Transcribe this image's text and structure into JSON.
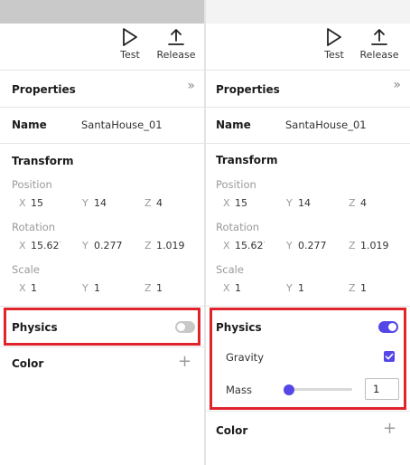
{
  "toolbar": {
    "test_label": "Test",
    "test_icon": "play-icon",
    "release_label": "Release",
    "release_icon": "upload-icon"
  },
  "properties": {
    "title": "Properties",
    "collapse_icon": "double-chevron-right-icon",
    "collapse_glyph": "»"
  },
  "name_field": {
    "label": "Name",
    "value": "SantaHouse_01"
  },
  "transform": {
    "title": "Transform",
    "position": {
      "label": "Position",
      "x_axis": "X",
      "y_axis": "Y",
      "z_axis": "Z",
      "x": "15",
      "y": "14",
      "z": "4"
    },
    "rotation": {
      "label": "Rotation",
      "x_axis": "X",
      "y_axis": "Y",
      "z_axis": "Z",
      "x": "15.627",
      "y": "0.277",
      "z": "1.019"
    },
    "scale": {
      "label": "Scale",
      "x_axis": "X",
      "y_axis": "Y",
      "z_axis": "Z",
      "x": "1",
      "y": "1",
      "z": "1"
    }
  },
  "physics_left": {
    "label": "Physics",
    "enabled": false
  },
  "physics_right": {
    "label": "Physics",
    "enabled": true,
    "gravity_label": "Gravity",
    "gravity_checked": true,
    "mass_label": "Mass",
    "mass_value": "1",
    "mass_slider_fraction": 0
  },
  "color_section": {
    "label": "Color",
    "add_glyph": "+",
    "add_icon": "plus-icon"
  },
  "colors": {
    "accent": "#5546e8",
    "highlight": "#e0242c",
    "toggle_off": "#c8c8c8"
  }
}
